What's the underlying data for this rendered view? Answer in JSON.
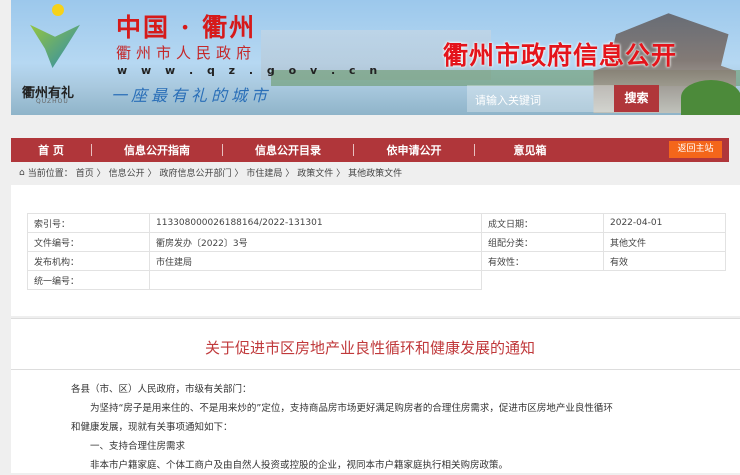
{
  "header": {
    "cn_title": "中国 · 衢州",
    "gov_name": "衢州市人民政府",
    "url": "w w w . q z . g o v . c n",
    "slogan": "一座最有礼的城市",
    "logo_text": "衢州有礼",
    "logo_sub": "QUZHOU",
    "site_title": "衢州市政府信息公开",
    "search_placeholder": "请输入关键词",
    "search_button": "搜索"
  },
  "nav": {
    "items": [
      "首 页",
      "信息公开指南",
      "信息公开目录",
      "依申请公开",
      "意见箱"
    ],
    "back": "返回主站"
  },
  "breadcrumb": {
    "label": "当前位置：",
    "items": [
      "首页 〉",
      "信息公开 〉",
      "政府信息公开部门 〉",
      "市住建局 〉",
      "政策文件 〉",
      "其他政策文件"
    ]
  },
  "meta": {
    "index_label": "索引号：",
    "index": "113308000026188164/2022-131301",
    "date_label": "成文日期：",
    "date": "2022-04-01",
    "doc_no_label": "文件编号：",
    "doc_no": "衢房发办〔2022〕3号",
    "category_label": "组配分类：",
    "category": "其他文件",
    "org_label": "发布机构：",
    "org": "市住建局",
    "validity_label": "有效性：",
    "validity": "有效",
    "unified_label": "统一编号：",
    "unified": ""
  },
  "article": {
    "title": "关于促进市区房地产业良性循环和健康发展的通知",
    "paragraphs": [
      "各县（市、区）人民政府，市级有关部门：",
      "　　为坚持“房子是用来住的、不是用来炒的”定位，支持商品房市场更好满足购房者的合理住房需求，促进市区房地产业良性循环",
      "和健康发展，现就有关事项通知如下：",
      "　　一、支持合理住房需求",
      "　　非本市户籍家庭、个体工商户及由自然人投资或控股的企业，视同本市户籍家庭执行相关购房政策。"
    ]
  }
}
